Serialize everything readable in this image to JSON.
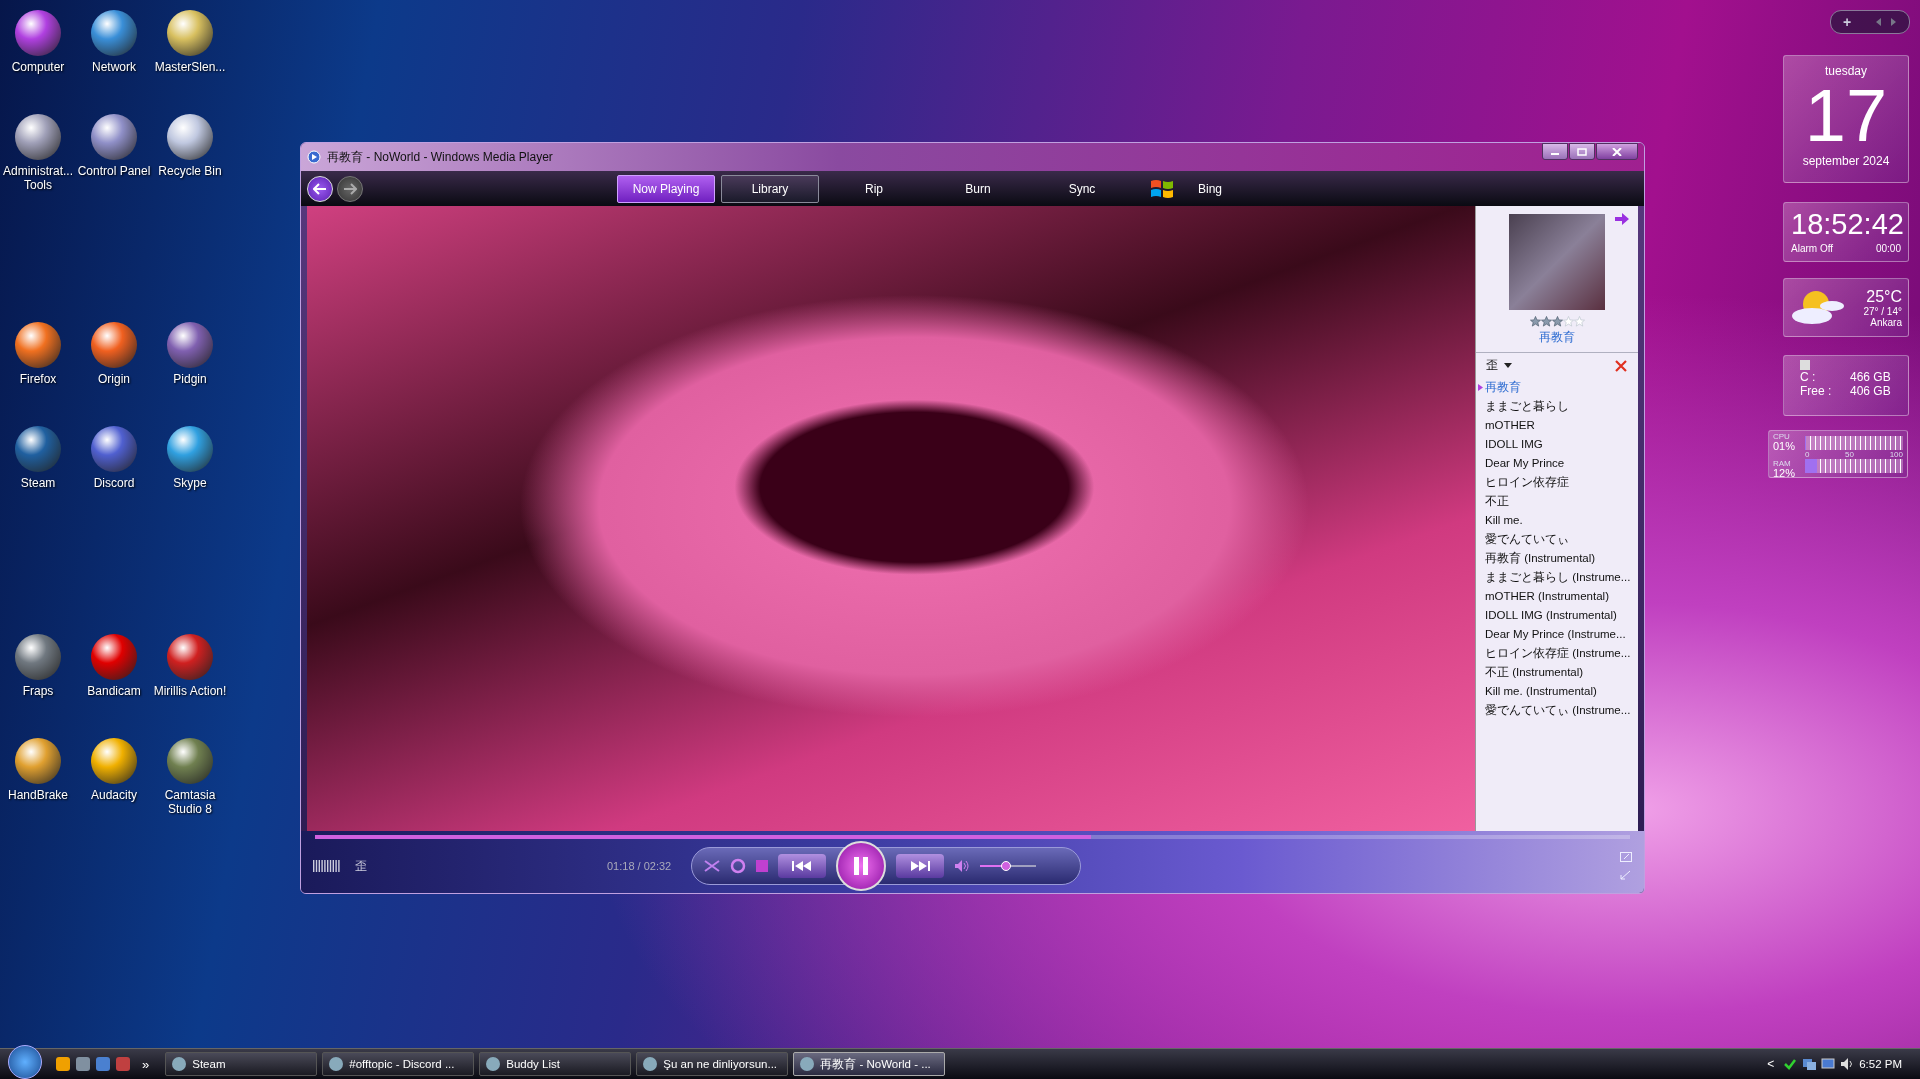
{
  "desktop_icon_rows": [
    [
      {
        "label": "Computer"
      },
      {
        "label": "Network"
      },
      {
        "label": "MasterSlen..."
      }
    ],
    [
      {
        "label": "Administrat... Tools"
      },
      {
        "label": "Control Panel"
      },
      {
        "label": "Recycle Bin"
      }
    ],
    [
      {
        "label": "Firefox"
      },
      {
        "label": "Origin"
      },
      {
        "label": "Pidgin"
      }
    ],
    [
      {
        "label": "Steam"
      },
      {
        "label": "Discord"
      },
      {
        "label": "Skype"
      }
    ],
    [
      {
        "label": "Fraps"
      },
      {
        "label": "Bandicam"
      },
      {
        "label": "Mirillis Action!"
      }
    ],
    [
      {
        "label": "HandBrake"
      },
      {
        "label": "Audacity"
      },
      {
        "label": "Camtasia Studio 8"
      }
    ]
  ],
  "media_player": {
    "title": "再教育 - NoWorld - Windows Media Player",
    "tabs": [
      {
        "label": "Now Playing",
        "selected": true
      },
      {
        "label": "Library",
        "selected": false
      },
      {
        "label": "Rip",
        "selected": false
      },
      {
        "label": "Burn",
        "selected": false
      },
      {
        "label": "Sync",
        "selected": false
      },
      {
        "label": "Bing",
        "selected": false
      }
    ],
    "now_playing": {
      "stars": 3,
      "title": "再教育"
    },
    "playlist": {
      "title": "歪",
      "items": [
        {
          "label": "再教育",
          "selected": true
        },
        {
          "label": "ままごと暮らし",
          "selected": false
        },
        {
          "label": "mOTHER",
          "selected": false
        },
        {
          "label": "IDOLL IMG",
          "selected": false
        },
        {
          "label": "Dear My Prince",
          "selected": false
        },
        {
          "label": "ヒロイン依存症",
          "selected": false
        },
        {
          "label": "不正",
          "selected": false
        },
        {
          "label": "Kill me.",
          "selected": false
        },
        {
          "label": "愛でんていてぃ",
          "selected": false
        },
        {
          "label": "再教育 (Instrumental)",
          "selected": false
        },
        {
          "label": "ままごと暮らし (Instrume...",
          "selected": false
        },
        {
          "label": "mOTHER (Instrumental)",
          "selected": false
        },
        {
          "label": "IDOLL IMG (Instrumental)",
          "selected": false
        },
        {
          "label": "Dear My Prince (Instrume...",
          "selected": false
        },
        {
          "label": "ヒロイン依存症 (Instrume...",
          "selected": false
        },
        {
          "label": "不正 (Instrumental)",
          "selected": false
        },
        {
          "label": "Kill me. (Instrumental)",
          "selected": false
        },
        {
          "label": "愛でんていてぃ (Instrume...",
          "selected": false
        }
      ]
    },
    "seek": {
      "level": 0.59
    },
    "album_label": "歪",
    "time": "01:18 / 02:32",
    "volume": {
      "level": 0.46
    }
  },
  "gadgets": {
    "calendar": {
      "weekday": "tuesday",
      "day": "17",
      "month_year": "september 2024"
    },
    "clock": {
      "time": "18:52:42",
      "alarm": "Alarm Off",
      "alarm_time": "00:00"
    },
    "weather": {
      "temperature": "25°C",
      "range": "27° / 14°",
      "city": "Ankara"
    },
    "drive": {
      "drive_label": "C :",
      "drive_size": "466 GB",
      "free_label": "Free :",
      "free_size": "406 GB"
    },
    "meter": {
      "cpu_label": "CPU",
      "cpu_value": "01%",
      "cpu": {
        "level": 0.01
      },
      "scale": [
        "0",
        "50",
        "100"
      ],
      "ram_label": "RAM",
      "ram_value": "12%",
      "ram": {
        "level": 0.12
      }
    },
    "toolbar": {
      "add": "+"
    }
  },
  "taskbar": {
    "more": "»",
    "tasks": [
      {
        "label": "Steam",
        "selected": false
      },
      {
        "label": "#offtopic - Discord ...",
        "selected": false
      },
      {
        "label": "Buddy List",
        "selected": false
      },
      {
        "label": "Şu an ne dinliyorsun...",
        "selected": false
      },
      {
        "label": "再教育 - NoWorld - ...",
        "selected": true
      }
    ],
    "tray_expand": "<",
    "clock": "6:52 PM"
  }
}
